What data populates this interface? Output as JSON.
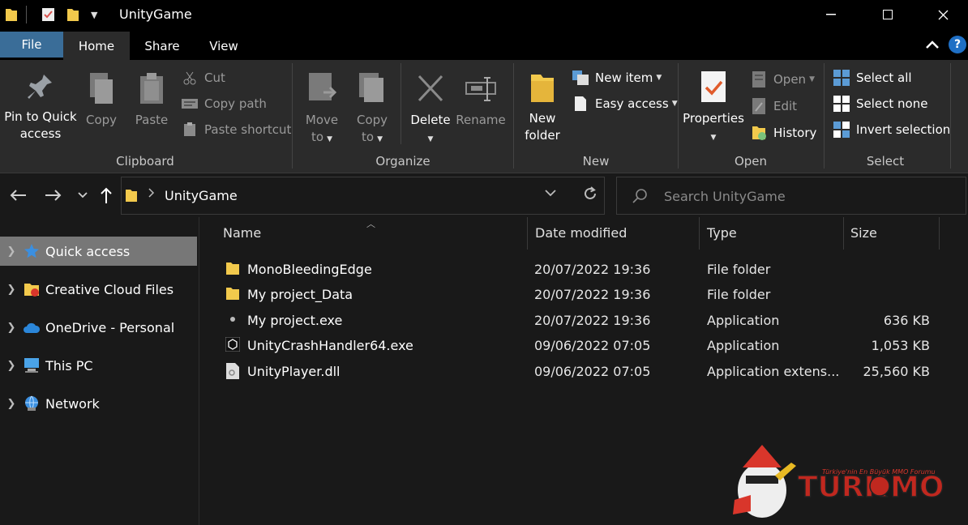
{
  "window": {
    "title": "UnityGame"
  },
  "colors": {
    "accent": "#3a6d98",
    "folder": "#f2c94c",
    "help": "#1f6fc5"
  },
  "tabs": [
    "File",
    "Home",
    "Share",
    "View"
  ],
  "ribbon": {
    "clipboard": {
      "label": "Clipboard",
      "pin": "Pin to Quick access",
      "copy": "Copy",
      "paste": "Paste",
      "cut": "Cut",
      "copy_path": "Copy path",
      "paste_shortcut": "Paste shortcut"
    },
    "organize": {
      "label": "Organize",
      "move_to": "Move to",
      "copy_to": "Copy to",
      "delete": "Delete",
      "rename": "Rename"
    },
    "new": {
      "label": "New",
      "new_folder": "New folder",
      "new_item": "New item",
      "easy_access": "Easy access"
    },
    "open": {
      "label": "Open",
      "properties": "Properties",
      "open": "Open",
      "edit": "Edit",
      "history": "History"
    },
    "select": {
      "label": "Select",
      "select_all": "Select all",
      "select_none": "Select none",
      "invert": "Invert selection"
    }
  },
  "address": {
    "crumb": "UnityGame",
    "search_placeholder": "Search UnityGame"
  },
  "nav": [
    {
      "label": "Quick access",
      "icon": "star-icon"
    },
    {
      "label": "Creative Cloud Files",
      "icon": "cc-folder-icon"
    },
    {
      "label": "OneDrive - Personal",
      "icon": "cloud-icon"
    },
    {
      "label": "This PC",
      "icon": "pc-icon"
    },
    {
      "label": "Network",
      "icon": "network-icon"
    }
  ],
  "columns": {
    "name": "Name",
    "date": "Date modified",
    "type": "Type",
    "size": "Size"
  },
  "files": [
    {
      "name": "MonoBleedingEdge",
      "date": "20/07/2022 19:36",
      "type": "File folder",
      "size": "",
      "icon": "folder-icon"
    },
    {
      "name": "My project_Data",
      "date": "20/07/2022 19:36",
      "type": "File folder",
      "size": "",
      "icon": "folder-icon"
    },
    {
      "name": "My project.exe",
      "date": "20/07/2022 19:36",
      "type": "Application",
      "size": "636 KB",
      "icon": "app-icon"
    },
    {
      "name": "UnityCrashHandler64.exe",
      "date": "09/06/2022 07:05",
      "type": "Application",
      "size": "1,053 KB",
      "icon": "unity-icon"
    },
    {
      "name": "UnityPlayer.dll",
      "date": "09/06/2022 07:05",
      "type": "Application extens...",
      "size": "25,560 KB",
      "icon": "dll-icon"
    }
  ],
  "watermark": {
    "brand": "TURKMMO",
    "tagline": "Türkiye'nin En Büyük MMO Forumu"
  }
}
